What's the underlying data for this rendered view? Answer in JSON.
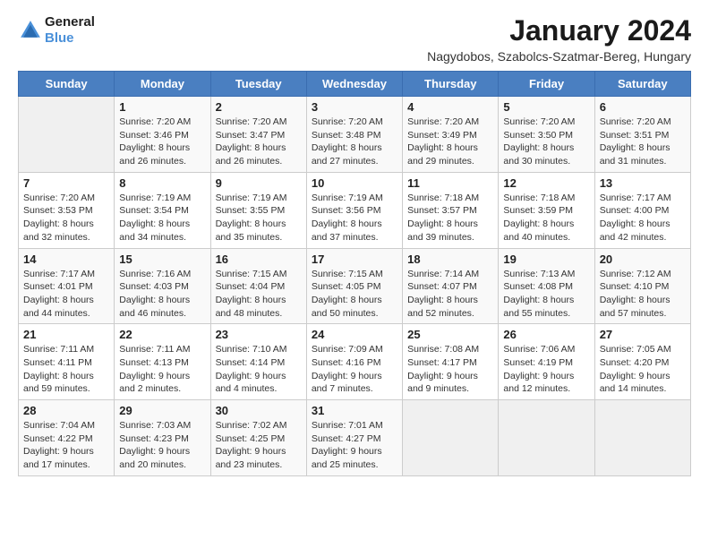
{
  "header": {
    "logo_line1": "General",
    "logo_line2": "Blue",
    "month_title": "January 2024",
    "location": "Nagydobos, Szabolcs-Szatmar-Bereg, Hungary"
  },
  "weekdays": [
    "Sunday",
    "Monday",
    "Tuesday",
    "Wednesday",
    "Thursday",
    "Friday",
    "Saturday"
  ],
  "weeks": [
    [
      {
        "day": "",
        "content": ""
      },
      {
        "day": "1",
        "content": "Sunrise: 7:20 AM\nSunset: 3:46 PM\nDaylight: 8 hours\nand 26 minutes."
      },
      {
        "day": "2",
        "content": "Sunrise: 7:20 AM\nSunset: 3:47 PM\nDaylight: 8 hours\nand 26 minutes."
      },
      {
        "day": "3",
        "content": "Sunrise: 7:20 AM\nSunset: 3:48 PM\nDaylight: 8 hours\nand 27 minutes."
      },
      {
        "day": "4",
        "content": "Sunrise: 7:20 AM\nSunset: 3:49 PM\nDaylight: 8 hours\nand 29 minutes."
      },
      {
        "day": "5",
        "content": "Sunrise: 7:20 AM\nSunset: 3:50 PM\nDaylight: 8 hours\nand 30 minutes."
      },
      {
        "day": "6",
        "content": "Sunrise: 7:20 AM\nSunset: 3:51 PM\nDaylight: 8 hours\nand 31 minutes."
      }
    ],
    [
      {
        "day": "7",
        "content": "Sunrise: 7:20 AM\nSunset: 3:53 PM\nDaylight: 8 hours\nand 32 minutes."
      },
      {
        "day": "8",
        "content": "Sunrise: 7:19 AM\nSunset: 3:54 PM\nDaylight: 8 hours\nand 34 minutes."
      },
      {
        "day": "9",
        "content": "Sunrise: 7:19 AM\nSunset: 3:55 PM\nDaylight: 8 hours\nand 35 minutes."
      },
      {
        "day": "10",
        "content": "Sunrise: 7:19 AM\nSunset: 3:56 PM\nDaylight: 8 hours\nand 37 minutes."
      },
      {
        "day": "11",
        "content": "Sunrise: 7:18 AM\nSunset: 3:57 PM\nDaylight: 8 hours\nand 39 minutes."
      },
      {
        "day": "12",
        "content": "Sunrise: 7:18 AM\nSunset: 3:59 PM\nDaylight: 8 hours\nand 40 minutes."
      },
      {
        "day": "13",
        "content": "Sunrise: 7:17 AM\nSunset: 4:00 PM\nDaylight: 8 hours\nand 42 minutes."
      }
    ],
    [
      {
        "day": "14",
        "content": "Sunrise: 7:17 AM\nSunset: 4:01 PM\nDaylight: 8 hours\nand 44 minutes."
      },
      {
        "day": "15",
        "content": "Sunrise: 7:16 AM\nSunset: 4:03 PM\nDaylight: 8 hours\nand 46 minutes."
      },
      {
        "day": "16",
        "content": "Sunrise: 7:15 AM\nSunset: 4:04 PM\nDaylight: 8 hours\nand 48 minutes."
      },
      {
        "day": "17",
        "content": "Sunrise: 7:15 AM\nSunset: 4:05 PM\nDaylight: 8 hours\nand 50 minutes."
      },
      {
        "day": "18",
        "content": "Sunrise: 7:14 AM\nSunset: 4:07 PM\nDaylight: 8 hours\nand 52 minutes."
      },
      {
        "day": "19",
        "content": "Sunrise: 7:13 AM\nSunset: 4:08 PM\nDaylight: 8 hours\nand 55 minutes."
      },
      {
        "day": "20",
        "content": "Sunrise: 7:12 AM\nSunset: 4:10 PM\nDaylight: 8 hours\nand 57 minutes."
      }
    ],
    [
      {
        "day": "21",
        "content": "Sunrise: 7:11 AM\nSunset: 4:11 PM\nDaylight: 8 hours\nand 59 minutes."
      },
      {
        "day": "22",
        "content": "Sunrise: 7:11 AM\nSunset: 4:13 PM\nDaylight: 9 hours\nand 2 minutes."
      },
      {
        "day": "23",
        "content": "Sunrise: 7:10 AM\nSunset: 4:14 PM\nDaylight: 9 hours\nand 4 minutes."
      },
      {
        "day": "24",
        "content": "Sunrise: 7:09 AM\nSunset: 4:16 PM\nDaylight: 9 hours\nand 7 minutes."
      },
      {
        "day": "25",
        "content": "Sunrise: 7:08 AM\nSunset: 4:17 PM\nDaylight: 9 hours\nand 9 minutes."
      },
      {
        "day": "26",
        "content": "Sunrise: 7:06 AM\nSunset: 4:19 PM\nDaylight: 9 hours\nand 12 minutes."
      },
      {
        "day": "27",
        "content": "Sunrise: 7:05 AM\nSunset: 4:20 PM\nDaylight: 9 hours\nand 14 minutes."
      }
    ],
    [
      {
        "day": "28",
        "content": "Sunrise: 7:04 AM\nSunset: 4:22 PM\nDaylight: 9 hours\nand 17 minutes."
      },
      {
        "day": "29",
        "content": "Sunrise: 7:03 AM\nSunset: 4:23 PM\nDaylight: 9 hours\nand 20 minutes."
      },
      {
        "day": "30",
        "content": "Sunrise: 7:02 AM\nSunset: 4:25 PM\nDaylight: 9 hours\nand 23 minutes."
      },
      {
        "day": "31",
        "content": "Sunrise: 7:01 AM\nSunset: 4:27 PM\nDaylight: 9 hours\nand 25 minutes."
      },
      {
        "day": "",
        "content": ""
      },
      {
        "day": "",
        "content": ""
      },
      {
        "day": "",
        "content": ""
      }
    ]
  ]
}
